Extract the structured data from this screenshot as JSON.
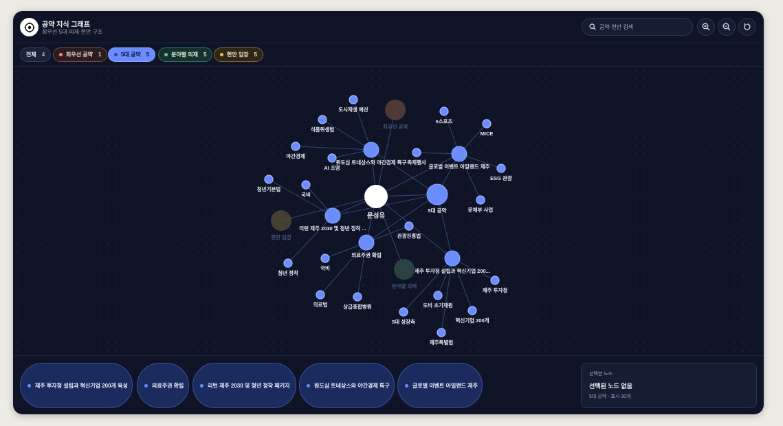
{
  "header": {
    "title": "공약 지식 그래프",
    "subtitle": "최우선·5대·의제·현안 구조",
    "search_placeholder": "공약·현안 검색"
  },
  "toolbar": {
    "zoom_in": "zoom-in-icon",
    "zoom_out": "zoom-out-icon",
    "reset": "reset-icon"
  },
  "filters": [
    {
      "label": "전체",
      "count": "4",
      "color": ""
    },
    {
      "label": "최우선 공약",
      "count": "1",
      "color": "#ff8a5b"
    },
    {
      "label": "5대 공약",
      "count": "5",
      "color": "#6b8cff",
      "active": true
    },
    {
      "label": "분야별 의제",
      "count": "5",
      "color": "#4fd29a"
    },
    {
      "label": "현안 입장",
      "count": "5",
      "color": "#f2b84b"
    }
  ],
  "graph": {
    "center": {
      "label": "문성유"
    },
    "categories": [
      {
        "label": "5대 공약"
      },
      {
        "label": "최우선 공약"
      },
      {
        "label": "현안 입장"
      },
      {
        "label": "분야별 의제"
      }
    ],
    "pledges": [
      {
        "label": "원도심 트네상스와 야간경제 특구"
      },
      {
        "label": "글로벌 이벤트 아일랜드 제주"
      },
      {
        "label": "리턴 제주 2030 및 청년 정착 ..."
      },
      {
        "label": "의료주권 확립"
      },
      {
        "label": "제주 투자청 설립과 혁신기업 200..."
      }
    ],
    "leaves": [
      {
        "label": "도시재생 예산"
      },
      {
        "label": "식품위생법"
      },
      {
        "label": "야간경제"
      },
      {
        "label": "AI 조명"
      },
      {
        "label": "축제행사"
      },
      {
        "label": "e스포츠"
      },
      {
        "label": "MICE"
      },
      {
        "label": "ESG 관광"
      },
      {
        "label": "문체부 사업"
      },
      {
        "label": "청년기본법"
      },
      {
        "label": "국비"
      },
      {
        "label": "청년 정착"
      },
      {
        "label": "관광진흥법"
      },
      {
        "label": "국비"
      },
      {
        "label": "의료법"
      },
      {
        "label": "상급종합병원"
      },
      {
        "label": "제주 투자청"
      },
      {
        "label": "혁신기업 200개"
      },
      {
        "label": "도비 초기재원"
      },
      {
        "label": "5대 성장축"
      },
      {
        "label": "제주특별법"
      }
    ]
  },
  "bottom": {
    "cards": [
      "제주 투자청 설립과 혁신기업 200개 육성",
      "의료주권 확립",
      "리턴 제주 2030 및 청년 정착 패키지",
      "원도심 트네상스와 야간경제 특구",
      "글로벌 이벤트 아일랜드 제주"
    ],
    "selected": {
      "caption": "선택한 노드",
      "title": "선택된 노드 없음",
      "meta": "5대 공약 · 표시 30개"
    }
  },
  "colors": {
    "pledge": "#6b8cff",
    "center": "#ffffff",
    "edge": "#3d4e86",
    "muted_priority": "#5a3f3a",
    "muted_issue": "#4d4733",
    "muted_agenda": "#2f4a46"
  }
}
